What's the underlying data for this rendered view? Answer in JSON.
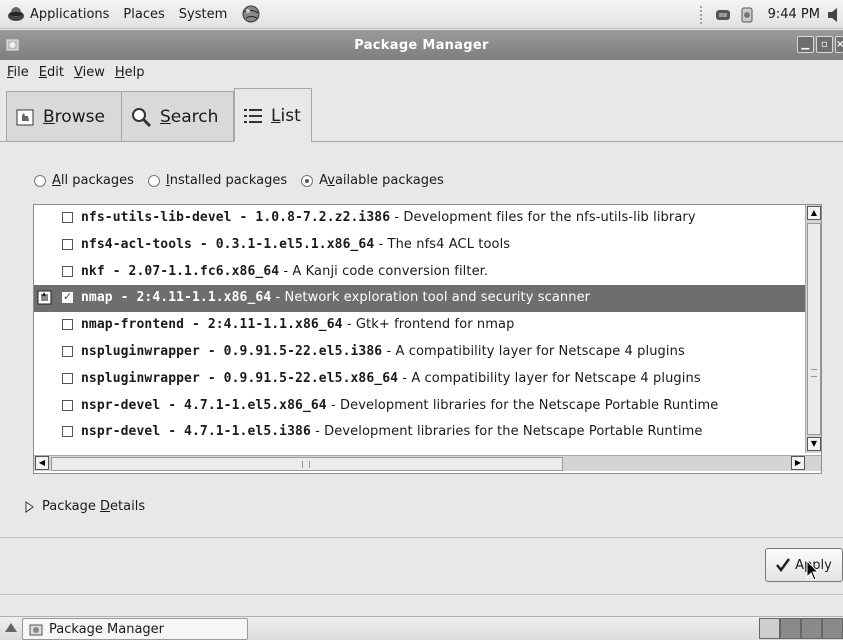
{
  "top_panel": {
    "menus": [
      "Applications",
      "Places",
      "System"
    ],
    "clock": "9:44 PM"
  },
  "window": {
    "title": "Package Manager",
    "menus": [
      {
        "label": "File",
        "mnemonic": "F"
      },
      {
        "label": "Edit",
        "mnemonic": "E"
      },
      {
        "label": "View",
        "mnemonic": "V"
      },
      {
        "label": "Help",
        "mnemonic": "H"
      }
    ]
  },
  "tabs": [
    {
      "label_pre": "",
      "mnemonic": "B",
      "label_post": "rowse",
      "icon": "browse-icon"
    },
    {
      "label_pre": "",
      "mnemonic": "S",
      "label_post": "earch",
      "icon": "search-icon"
    },
    {
      "label_pre": "",
      "mnemonic": "L",
      "label_post": "ist",
      "icon": "list-icon",
      "active": true
    }
  ],
  "filters": [
    {
      "mnemonic": "A",
      "rest": "ll packages",
      "pre": "",
      "selected": false
    },
    {
      "mnemonic": "I",
      "rest": "nstalled packages",
      "pre": "",
      "selected": false
    },
    {
      "pre": "A",
      "mnemonic": "v",
      "rest": "ailable packages",
      "selected": true
    }
  ],
  "packages": [
    {
      "name": "nfs-utils-lib-devel - 1.0.8-7.2.z2.i386",
      "desc": " - Development files for the nfs-utils-lib library",
      "checked": false,
      "selected": false
    },
    {
      "name": "nfs4-acl-tools - 0.3.1-1.el5.1.x86_64",
      "desc": " - The nfs4 ACL tools",
      "checked": false,
      "selected": false
    },
    {
      "name": "nkf - 2.07-1.1.fc6.x86_64",
      "desc": " - A Kanji code conversion filter.",
      "checked": false,
      "selected": false
    },
    {
      "name": "nmap - 2:4.11-1.1.x86_64",
      "desc": " - Network exploration tool and security scanner",
      "checked": true,
      "selected": true
    },
    {
      "name": "nmap-frontend - 2:4.11-1.1.x86_64",
      "desc": " - Gtk+ frontend for nmap",
      "checked": false,
      "selected": false
    },
    {
      "name": "nspluginwrapper - 0.9.91.5-22.el5.i386",
      "desc": " - A compatibility layer for Netscape 4 plugins",
      "checked": false,
      "selected": false
    },
    {
      "name": "nspluginwrapper - 0.9.91.5-22.el5.x86_64",
      "desc": " - A compatibility layer for Netscape 4 plugins",
      "checked": false,
      "selected": false
    },
    {
      "name": "nspr-devel - 4.7.1-1.el5.x86_64",
      "desc": " - Development libraries for the Netscape Portable Runtime",
      "checked": false,
      "selected": false
    },
    {
      "name": "nspr-devel - 4.7.1-1.el5.i386",
      "desc": " - Development libraries for the Netscape Portable Runtime",
      "checked": false,
      "selected": false
    }
  ],
  "details": {
    "pre": "Package ",
    "mnemonic": "D",
    "rest": "etails"
  },
  "apply": {
    "pre": "A",
    "mnemonic": "p",
    "rest": "ply"
  },
  "taskbar": {
    "task_label": "Package Manager"
  },
  "colors": {
    "selection": "#6e6e6e",
    "title_bar": "#8a8a8a"
  }
}
